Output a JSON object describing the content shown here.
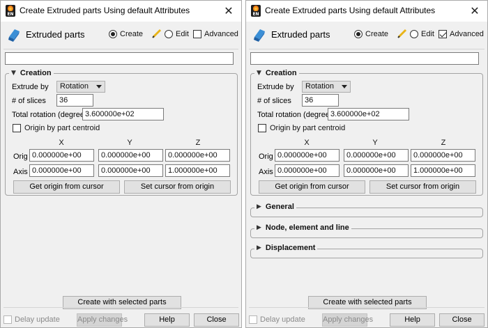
{
  "windows": [
    {
      "title": "Create Extruded parts Using default Attributes",
      "app_icon_text": "EN",
      "panel_label": "Extruded parts",
      "create_label": "Create",
      "edit_label": "Edit",
      "advanced_label": "Advanced",
      "advanced_checked": false,
      "creation": {
        "title": "Creation",
        "extrude_by_label": "Extrude by",
        "extrude_by_value": "Rotation",
        "slices_label": "# of slices",
        "slices_value": "36",
        "rotation_label": "Total rotation (degrees)",
        "rotation_value": "3.600000e+02",
        "centroid_label": "Origin by part centroid",
        "col_x": "X",
        "col_y": "Y",
        "col_z": "Z",
        "orig_label": "Orig",
        "orig_x": "0.000000e+00",
        "orig_y": "0.000000e+00",
        "orig_z": "0.000000e+00",
        "axis_label": "Axis",
        "axis_x": "0.000000e+00",
        "axis_y": "0.000000e+00",
        "axis_z": "1.000000e+00",
        "get_origin_label": "Get origin from cursor",
        "set_cursor_label": "Set cursor from origin"
      },
      "create_selected_label": "Create with selected parts",
      "delay_update_label": "Delay update",
      "apply_changes_label": "Apply changes",
      "help_label": "Help",
      "close_label": "Close"
    },
    {
      "title": "Create Extruded parts Using default Attributes",
      "app_icon_text": "EN",
      "panel_label": "Extruded parts",
      "create_label": "Create",
      "edit_label": "Edit",
      "advanced_label": "Advanced",
      "advanced_checked": true,
      "creation": {
        "title": "Creation",
        "extrude_by_label": "Extrude by",
        "extrude_by_value": "Rotation",
        "slices_label": "# of slices",
        "slices_value": "36",
        "rotation_label": "Total rotation (degrees)",
        "rotation_value": "3.600000e+02",
        "centroid_label": "Origin by part centroid",
        "col_x": "X",
        "col_y": "Y",
        "col_z": "Z",
        "orig_label": "Orig",
        "orig_x": "0.000000e+00",
        "orig_y": "0.000000e+00",
        "orig_z": "0.000000e+00",
        "axis_label": "Axis",
        "axis_x": "0.000000e+00",
        "axis_y": "0.000000e+00",
        "axis_z": "1.000000e+00",
        "get_origin_label": "Get origin from cursor",
        "set_cursor_label": "Set cursor from origin"
      },
      "sections": [
        "General",
        "Node, element and line",
        "Displacement"
      ],
      "create_selected_label": "Create with selected parts",
      "delay_update_label": "Delay update",
      "apply_changes_label": "Apply changes",
      "help_label": "Help",
      "close_label": "Close"
    }
  ]
}
